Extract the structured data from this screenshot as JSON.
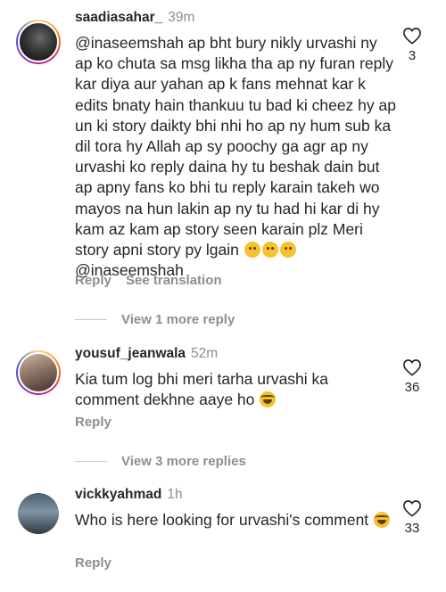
{
  "comments": [
    {
      "username": "saadiasahar_",
      "time": "39m",
      "mention": "@inaseemshah",
      "text": " ap bht bury nikly urvashi ny ap ko chuta sa msg likha tha ap ny furan reply kar diya aur yahan ap k fans mehnat kar k edits bnaty hain thankuu tu bad ki cheez hy ap un ki story daikty bhi nhi ho ap ny hum sub ka dil tora hy Allah ap sy poochy ga agr ap ny urvashi ko reply daina hy tu beshak dain but ap apny fans ko bhi tu reply karain takeh wo mayos na hun lakin ap ny tu had hi kar di hy kam az kam ap story seen karain plz Meri story apni story py lgain ",
      "tail_mention": " @inaseemshah",
      "emoji_icon": "crying-face-emoji",
      "likes": "3",
      "reply_label": "Reply",
      "translate_label": "See translation",
      "more_replies": "View 1 more reply"
    },
    {
      "username": "yousuf_jeanwala",
      "time": "52m",
      "text": "Kia tum log bhi meri tarha urvashi ka comment dekhne aaye ho ",
      "emoji_icon": "laughing-tears-emoji",
      "likes": "36",
      "reply_label": "Reply",
      "more_replies": "View 3 more replies"
    },
    {
      "username": "vickkyahmad",
      "time": "1h",
      "text": "Who is here looking for urvashi's comment ",
      "emoji_icon": "laughing-tears-emoji",
      "likes": "33",
      "reply_label": "Reply"
    }
  ],
  "colors": {
    "text": "#262626",
    "secondary": "#8e8e8e",
    "story_ring": "#d62976"
  }
}
